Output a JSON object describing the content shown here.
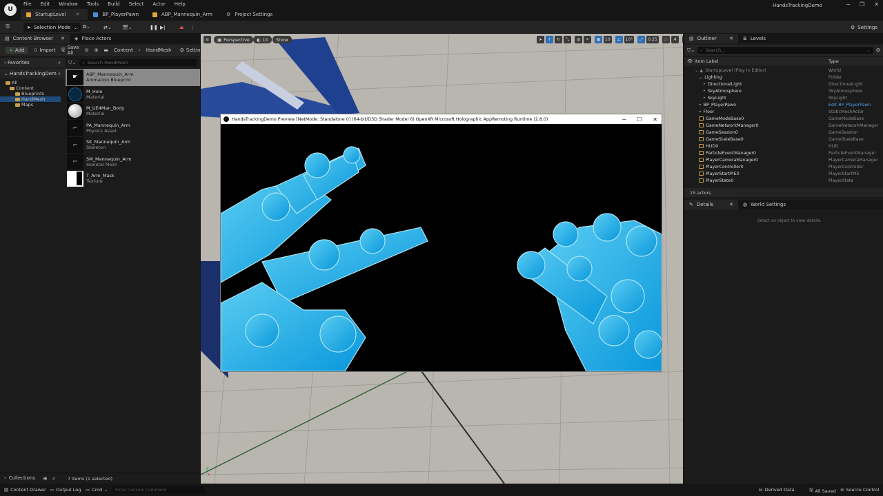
{
  "menu": [
    "File",
    "Edit",
    "Window",
    "Tools",
    "Build",
    "Select",
    "Actor",
    "Help"
  ],
  "app_title": "HandsTrackingDemo",
  "editor_tabs": [
    {
      "label": "StartupLevel",
      "icon": "level-icon"
    },
    {
      "label": "BP_PlayerPawn",
      "icon": "blueprint-icon"
    },
    {
      "label": "ABP_Mannequin_Arm",
      "icon": "anim-blueprint-icon"
    },
    {
      "label": "Project Settings",
      "icon": "gear-icon"
    }
  ],
  "toolbar": {
    "selection_mode": "Selection Mode",
    "settings": "Settings"
  },
  "left_tabs": {
    "content_browser": "Content Browser",
    "place_actors": "Place Actors"
  },
  "cb_toolbar": {
    "add": "Add",
    "import": "Import",
    "save_all": "Save All",
    "crumb1": "Content",
    "crumb2": "HandMesh",
    "settings": "Settings"
  },
  "favorites": "Favorites",
  "project_root": "HandsTrackingDem",
  "tree": [
    {
      "label": "All",
      "indent": 0
    },
    {
      "label": "Content",
      "indent": 1
    },
    {
      "label": "Blueprints",
      "indent": 2
    },
    {
      "label": "HandMesh",
      "indent": 2,
      "selected": true
    },
    {
      "label": "Maps",
      "indent": 2
    }
  ],
  "asset_search_placeholder": "Search HandMesh",
  "assets": [
    {
      "name": "ABP_Mannequin_Arm",
      "type": "Animation Blueprint",
      "selected": true
    },
    {
      "name": "M_Holo",
      "type": "Material"
    },
    {
      "name": "M_UE4Man_Body",
      "type": "Material"
    },
    {
      "name": "PA_Mannequin_Arm",
      "type": "Physics Asset"
    },
    {
      "name": "SK_Mannequin_Arm",
      "type": "Skeleton"
    },
    {
      "name": "SM_Mannequin_Arm",
      "type": "Skeletal Mesh"
    },
    {
      "name": "T_Arm_Mask",
      "type": "Texture"
    }
  ],
  "collections": "Collections",
  "items_count": "7 items (1 selected)",
  "viewport": {
    "perspective": "Perspective",
    "lit": "Lit",
    "show": "Show",
    "grid": "10",
    "angle": "10°",
    "scale": "0.25",
    "cams": "4"
  },
  "preview": {
    "title": "HandsTrackingDemo Preview [NetMode: Standalone 0]  (64-bit/D3D Shader Model 6) OpenXR Microsoft Holographic AppRemoting Runtime (2.8.0)"
  },
  "outliner": {
    "tab": "Outliner",
    "levels_tab": "Levels",
    "search_placeholder": "Search...",
    "col_label": "Item Label",
    "col_type": "Type",
    "rows": [
      {
        "label": "StartupLevel (Play In Editor)",
        "type": "World",
        "indent": 0
      },
      {
        "label": "Lighting",
        "type": "Folder",
        "indent": 1
      },
      {
        "label": "DirectionalLight",
        "type": "DirectionalLight",
        "indent": 2
      },
      {
        "label": "SkyAtmosphere",
        "type": "SkyAtmosphere",
        "indent": 2
      },
      {
        "label": "SkyLight",
        "type": "SkyLight",
        "indent": 2
      },
      {
        "label": "BP_PlayerPawn",
        "type": "Edit BP_PlayerPawn",
        "indent": 1,
        "link": true
      },
      {
        "label": "Floor",
        "type": "StaticMeshActor",
        "indent": 1
      },
      {
        "label": "GameModeBase0",
        "type": "GameModeBase",
        "indent": 1,
        "yellow": true
      },
      {
        "label": "GameNetworkManager0",
        "type": "GameNetworkManager",
        "indent": 1,
        "yellow": true
      },
      {
        "label": "GameSession0",
        "type": "GameSession",
        "indent": 1,
        "yellow": true
      },
      {
        "label": "GameStateBase0",
        "type": "GameStateBase",
        "indent": 1,
        "yellow": true
      },
      {
        "label": "HUD0",
        "type": "HUD",
        "indent": 1,
        "yellow": true
      },
      {
        "label": "ParticleEventManager0",
        "type": "ParticleEventManager",
        "indent": 1,
        "yellow": true
      },
      {
        "label": "PlayerCameraManager0",
        "type": "PlayerCameraManager",
        "indent": 1,
        "yellow": true
      },
      {
        "label": "PlayerController0",
        "type": "PlayerController",
        "indent": 1,
        "yellow": true
      },
      {
        "label": "PlayerStartPIE0",
        "type": "PlayerStartPIE",
        "indent": 1,
        "yellow": true
      },
      {
        "label": "PlayerState0",
        "type": "PlayerState",
        "indent": 1,
        "yellow": true
      }
    ],
    "actor_count": "15 actors"
  },
  "details": {
    "tab": "Details",
    "world_settings": "World Settings",
    "empty": "Select an object to view details."
  },
  "statusbar": {
    "content_drawer": "Content Drawer",
    "output_log": "Output Log",
    "cmd": "Cmd",
    "console_placeholder": "Enter Console Command",
    "derived_data": "Derived Data",
    "all_saved": "All Saved",
    "source_control": "Source Control"
  }
}
